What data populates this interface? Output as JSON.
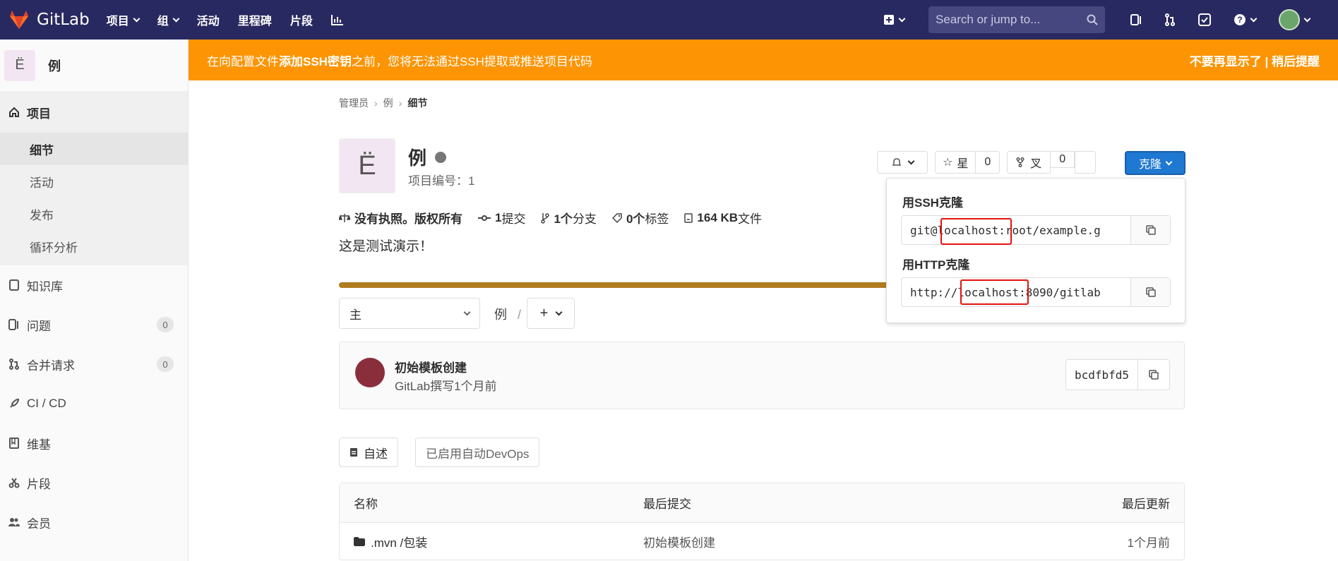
{
  "topnav": {
    "brand": "GitLab",
    "items": [
      "项目",
      "组",
      "活动",
      "里程碑",
      "片段"
    ],
    "search_placeholder": "Search or jump to..."
  },
  "sidebar": {
    "project_initial": "Ë",
    "project_name": "例",
    "section": "项目",
    "sub_items": [
      "细节",
      "活动",
      "发布",
      "循环分析"
    ],
    "items": [
      {
        "label": "知识库",
        "icon": "repository-icon"
      },
      {
        "label": "问题",
        "icon": "issues-icon",
        "badge": "0"
      },
      {
        "label": "合并请求",
        "icon": "merge-request-icon",
        "badge": "0"
      },
      {
        "label": "CI / CD",
        "icon": "rocket-icon"
      },
      {
        "label": "维基",
        "icon": "book-icon"
      },
      {
        "label": "片段",
        "icon": "snippet-icon"
      },
      {
        "label": "会员",
        "icon": "users-icon"
      }
    ]
  },
  "banner": {
    "text_before": "在向配置文件 ",
    "link": "添加SSH密钥",
    "text_after": "之前，您将无法通过SSH提取或推送项目代码",
    "right": "不要再显示了 | 稍后提醒"
  },
  "breadcrumb": [
    "管理员",
    "例",
    "细节"
  ],
  "project": {
    "initial": "Ë",
    "name": "例",
    "id_label": "项目编号：1",
    "license": "没有执照。版权所有",
    "commits_bold": "1",
    "commits": "提交",
    "branches_bold": "1个",
    "branches": "分支",
    "tags_bold": "0个",
    "tags": "标签",
    "files_bold": "164 KB",
    "files": "文件",
    "description": "这是测试演示！"
  },
  "actions": {
    "star": "星",
    "star_count": "0",
    "fork": "叉",
    "fork_count": "0",
    "clone": "克隆"
  },
  "clone_dropdown": {
    "ssh_label": "用SSH克隆",
    "ssh_url": "git@localhost:root/example.g",
    "http_label": "用HTTP克隆",
    "http_url": "http://localhost:8090/gitlab"
  },
  "repo": {
    "branch": "主",
    "path": "例",
    "path_sep": "/"
  },
  "commit": {
    "title": "初始模板创建",
    "subtitle": "GitLab撰写1个月前",
    "sha": "bcdfbfd5"
  },
  "buttons": {
    "readme": "自述",
    "devops": "已启用自动DevOps"
  },
  "table": {
    "headers": [
      "名称",
      "最后提交",
      "最后更新"
    ],
    "rows": [
      {
        "name": ".mvn /包装",
        "commit": "初始模板创建",
        "updated": "1个月前"
      }
    ]
  },
  "colors": {
    "navbar": "#292961",
    "banner": "#fc9403",
    "accent": "#1f78d1",
    "highlight": "#e4120e"
  }
}
